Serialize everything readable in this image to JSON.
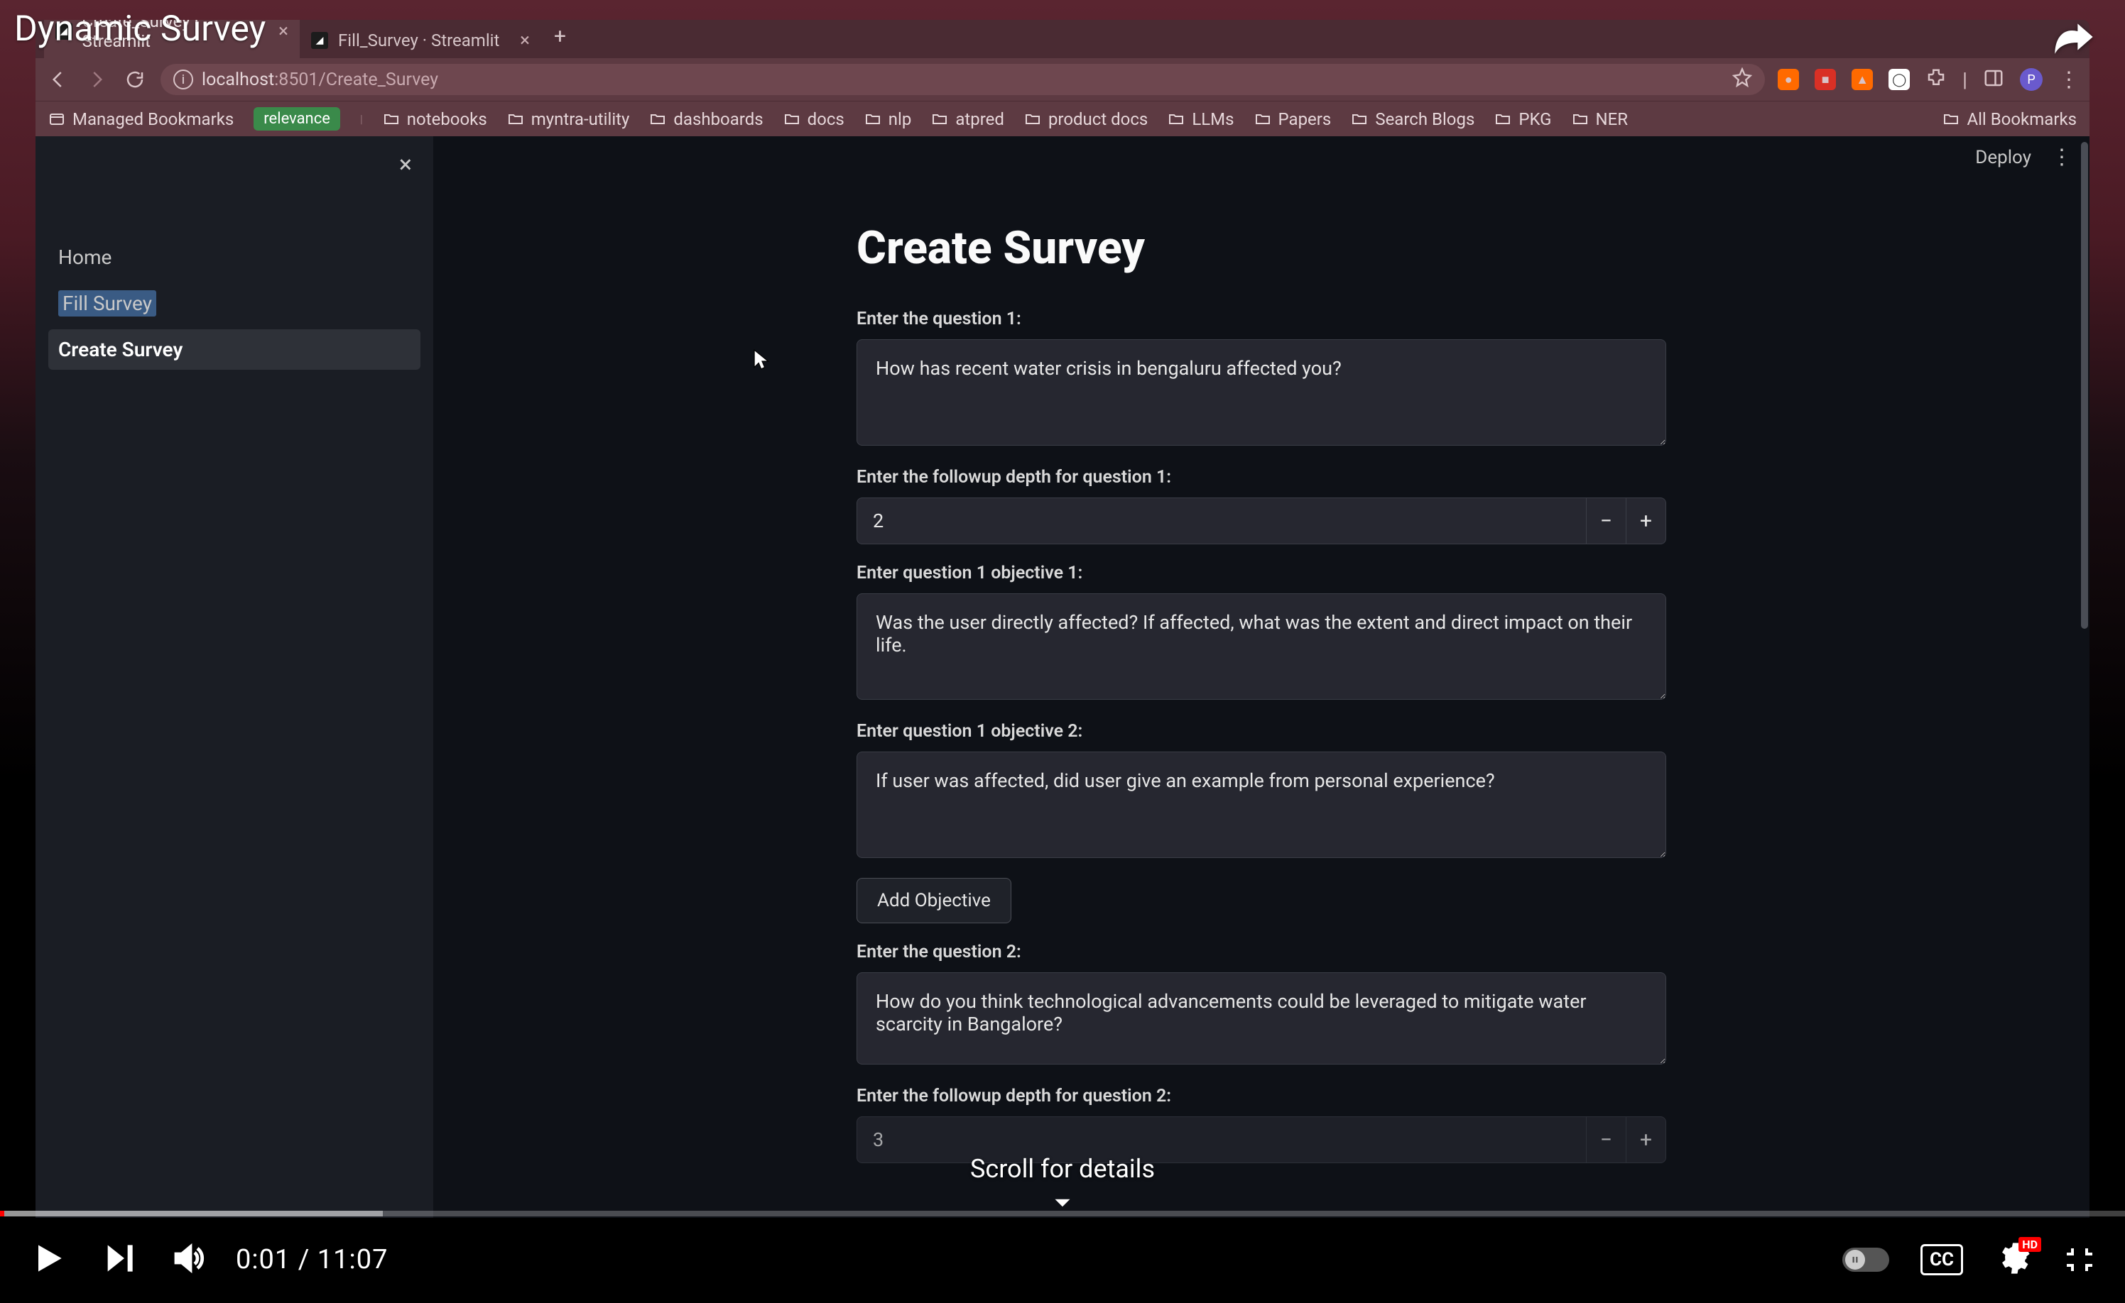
{
  "video": {
    "title": "Dynamic Survey",
    "current_time": "0:01",
    "duration": "11:07",
    "time_display": "0:01 / 11:07",
    "scroll_hint": "Scroll for details"
  },
  "browser": {
    "tabs": [
      {
        "title": "Create_Survey · Streamlit",
        "active": true
      },
      {
        "title": "Fill_Survey · Streamlit",
        "active": false
      }
    ],
    "url_host": "localhost",
    "url_port": ":8501",
    "url_path": "/Create_Survey",
    "bookmarks": {
      "managed": "Managed Bookmarks",
      "relevance": "relevance",
      "items": [
        "notebooks",
        "myntra-utility",
        "dashboards",
        "docs",
        "nlp",
        "atpred",
        "product docs",
        "LLMs",
        "Papers",
        "Search Blogs",
        "PKG",
        "NER"
      ],
      "all": "All Bookmarks"
    },
    "profile_initial": "P"
  },
  "app": {
    "deploy_label": "Deploy",
    "sidebar": {
      "items": [
        "Home",
        "Fill Survey",
        "Create Survey"
      ],
      "active_index": 2,
      "highlight_index": 1
    },
    "page_title": "Create Survey",
    "form": {
      "q1_label": "Enter the question 1:",
      "q1_value": "How has recent water crisis in bengaluru affected you?",
      "depth1_label": "Enter the followup depth for question 1:",
      "depth1_value": "2",
      "obj11_label": "Enter question 1 objective 1:",
      "obj11_value": "Was the user directly affected? If affected, what was the extent and direct impact on their life.",
      "obj12_label": "Enter question 1 objective 2:",
      "obj12_value": "If user was affected, did user give an example from personal experience?",
      "add_objective_label": "Add Objective",
      "q2_label": "Enter the question 2:",
      "q2_value": "How do you think technological advancements could be leveraged to mitigate water scarcity in Bangalore?",
      "depth2_label": "Enter the followup depth for question 2:",
      "depth2_value": "3"
    }
  },
  "player": {
    "cc": "CC",
    "hd": "HD"
  }
}
